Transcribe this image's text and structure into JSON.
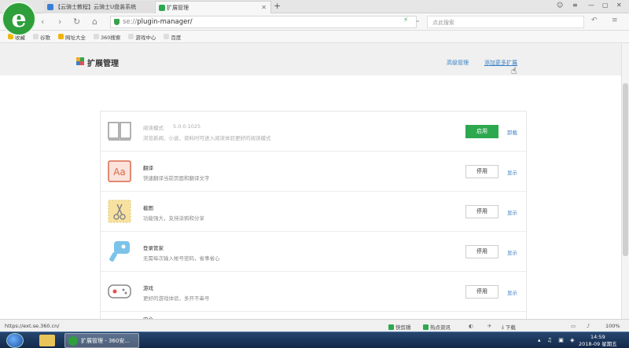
{
  "browser": {
    "logo_letter": "e",
    "tabs": [
      {
        "label": "【云骑士教程】云骑士U盘装系统",
        "active": false
      },
      {
        "label": "扩展管理",
        "active": true
      }
    ],
    "new_tab": "+",
    "address": {
      "scheme": "se://",
      "path": "plugin-manager/"
    },
    "search_placeholder": "点此搜索",
    "bookmarks": [
      "收藏",
      "谷歌",
      "网址大全",
      "360搜索",
      "游戏中心",
      "百度"
    ]
  },
  "page": {
    "title": "扩展管理",
    "advanced_label": "高级管理",
    "add_more_label": "添加更多扩展"
  },
  "extensions": [
    {
      "name": "阅读模式",
      "version": "5.0.0.1025",
      "desc": "浏览新闻、小说、资料时可进入阅读体验更好的阅读模式",
      "button": "启用",
      "link": "卸载",
      "enabled": false,
      "icon": "book-icon"
    },
    {
      "name": "翻译",
      "version": "",
      "desc": "快速翻译当前页面和翻译文字",
      "button": "停用",
      "link": "显示",
      "enabled": true,
      "icon": "translate-icon"
    },
    {
      "name": "截图",
      "version": "",
      "desc": "功能强大，支持涂鸦和分享",
      "button": "停用",
      "link": "显示",
      "enabled": true,
      "icon": "screenshot-scissors-icon"
    },
    {
      "name": "登录管家",
      "version": "",
      "desc": "无需每次输入帐号密码，省事省心",
      "button": "停用",
      "link": "显示",
      "enabled": true,
      "icon": "key-icon"
    },
    {
      "name": "游戏",
      "version": "",
      "desc": "更好的游戏体验，多开不串号",
      "button": "停用",
      "link": "显示",
      "enabled": true,
      "icon": "gamepad-icon"
    },
    {
      "name": "安全",
      "version": "",
      "desc": "",
      "button": "",
      "link": "",
      "enabled": true,
      "icon": "shield-icon"
    }
  ],
  "statusbar": {
    "url": "https://ext.se.360.cn/",
    "quick_cut": "快剪辑",
    "hot_news": "热点资讯",
    "download": "下载",
    "zoom": "100%"
  },
  "taskbar": {
    "app_label": "扩展管理 - 360安...",
    "time": "14:59",
    "date": "2018-09 星期五"
  },
  "colors": {
    "accent_green": "#2ea84f",
    "link_blue": "#3a80c5"
  }
}
